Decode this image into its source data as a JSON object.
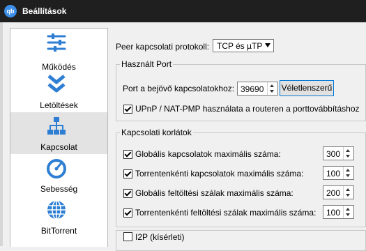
{
  "window": {
    "title": "Beállítások",
    "logo_text": "qb"
  },
  "sidebar": {
    "items": [
      {
        "label": "Működés",
        "icon": "sliders-icon"
      },
      {
        "label": "Letöltések",
        "icon": "double-chevron-down-icon"
      },
      {
        "label": "Kapcsolat",
        "icon": "network-icon",
        "selected": true
      },
      {
        "label": "Sebesség",
        "icon": "speedometer-icon"
      },
      {
        "label": "BitTorrent",
        "icon": "globe-icon"
      }
    ]
  },
  "protocol": {
    "label": "Peer kapcsolati protokoll:",
    "value": "TCP és µTP"
  },
  "listening_port": {
    "title": "Használt Port",
    "port_label": "Port a bejövő kapcsolatokhoz:",
    "port_value": "39690",
    "random_button": "Véletlenszerű",
    "upnp_label": "UPnP / NAT-PMP használata a routeren a porttovábbításhoz",
    "upnp_checked": true
  },
  "limits": {
    "title": "Kapcsolati korlátok",
    "rows": [
      {
        "label": "Globális kapcsolatok maximális száma:",
        "value": "300",
        "checked": true
      },
      {
        "label": "Torrentenkénti kapcsolatok maximális száma:",
        "value": "100",
        "checked": true
      },
      {
        "label": "Globális feltöltési szálak maximális száma:",
        "value": "200",
        "checked": true
      },
      {
        "label": "Torrentenkénti feltöltési szálak maximális száma:",
        "value": "100",
        "checked": true
      }
    ]
  },
  "i2p": {
    "label": "I2P (kísérleti)",
    "checked": false
  },
  "colors": {
    "titlebar": "#1f1f1f",
    "accent": "#2e7fd3",
    "selected_bg": "#e3e3e3"
  }
}
